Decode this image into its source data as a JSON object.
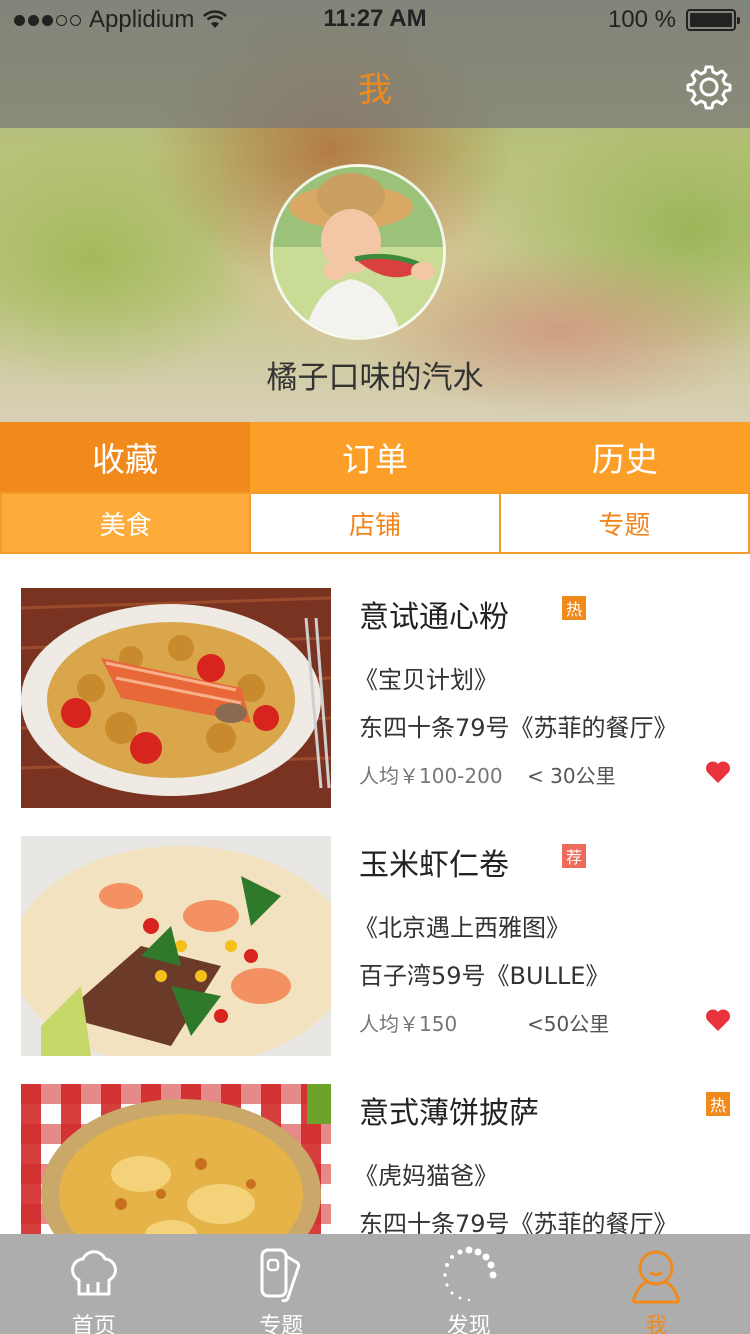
{
  "status_bar": {
    "carrier": "Applidium",
    "time": "11:27 AM",
    "battery": "100 %",
    "battery_level": 1.0
  },
  "header": {
    "title": "我",
    "settings_icon": "gear-icon"
  },
  "profile": {
    "username": "橘子口味的汽水"
  },
  "main_tabs": [
    {
      "label": "收藏",
      "active": true
    },
    {
      "label": "订单",
      "active": false
    },
    {
      "label": "历史",
      "active": false
    }
  ],
  "sub_tabs": [
    {
      "label": "美食",
      "active": true
    },
    {
      "label": "店铺",
      "active": false
    },
    {
      "label": "专题",
      "active": false
    }
  ],
  "items": [
    {
      "title": "意试通心粉",
      "badge": "热",
      "badge_type": "hot",
      "source": "《宝贝计划》",
      "address": "东四十条79号《苏菲的餐厅》",
      "price": "人均￥100-200",
      "distance": "< 30公里",
      "favorited": true
    },
    {
      "title": "玉米虾仁卷",
      "badge": "荐",
      "badge_type": "rec",
      "source": "《北京遇上西雅图》",
      "address": "百子湾59号《BULLE》",
      "price": "人均￥150",
      "distance": "<50公里",
      "favorited": true
    },
    {
      "title": "意式薄饼披萨",
      "badge": "热",
      "badge_type": "hot",
      "source": "《虎妈猫爸》",
      "address": "东四十条79号《苏菲的餐厅》",
      "price": "",
      "distance": "",
      "favorited": true
    }
  ],
  "tab_bar": [
    {
      "label": "首页",
      "icon": "chef-hat-icon",
      "active": false
    },
    {
      "label": "专题",
      "icon": "cards-icon",
      "active": false
    },
    {
      "label": "发现",
      "icon": "loading-dots-icon",
      "active": false
    },
    {
      "label": "我",
      "icon": "user-icon",
      "active": true
    }
  ],
  "colors": {
    "accent": "#f08a1c",
    "tab_bg": "#fc9f28",
    "heart": "#e8323c"
  }
}
